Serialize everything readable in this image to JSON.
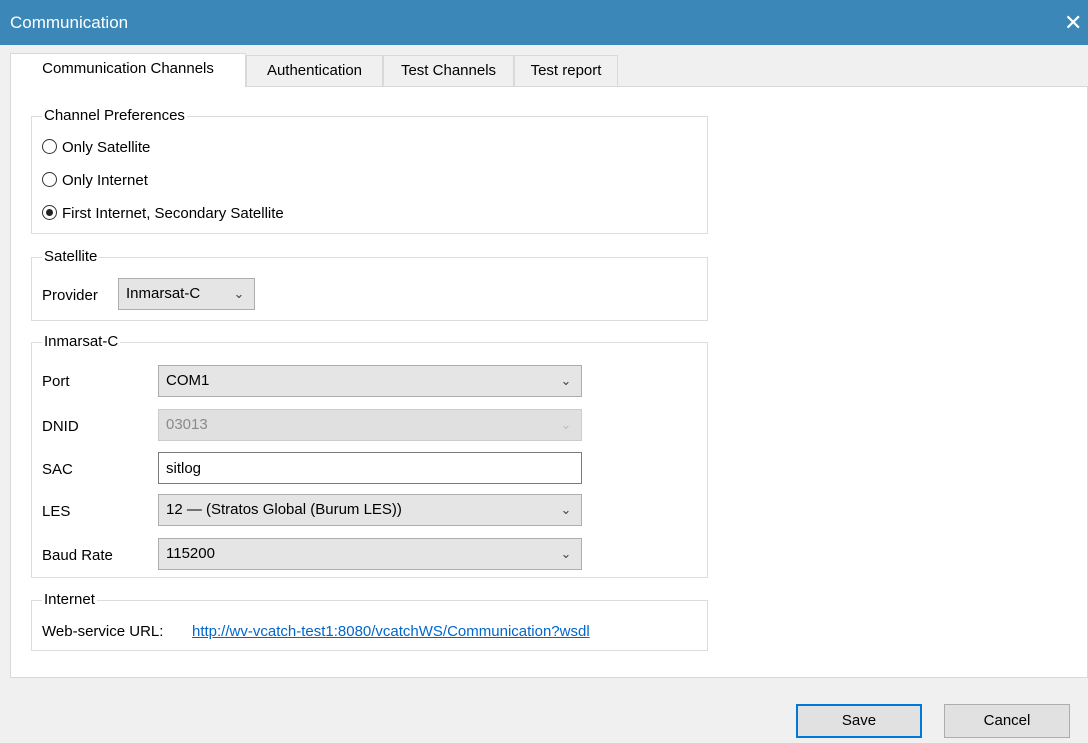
{
  "window": {
    "title": "Communication",
    "close_glyph": "✕"
  },
  "tabs": [
    {
      "label": "Communication Channels",
      "active": true
    },
    {
      "label": "Authentication",
      "active": false
    },
    {
      "label": "Test Channels",
      "active": false
    },
    {
      "label": "Test report",
      "active": false
    }
  ],
  "channel_preferences": {
    "legend": "Channel Preferences",
    "options": [
      {
        "label": "Only Satellite",
        "checked": false
      },
      {
        "label": "Only Internet",
        "checked": false
      },
      {
        "label": "First Internet, Secondary Satellite",
        "checked": true
      }
    ]
  },
  "satellite": {
    "legend": "Satellite",
    "provider_label": "Provider",
    "provider_value": "Inmarsat-C"
  },
  "inmarsat": {
    "legend": "Inmarsat-C",
    "port_label": "Port",
    "port_value": "COM1",
    "dnid_label": "DNID",
    "dnid_value": "03013",
    "sac_label": "SAC",
    "sac_value": "sitlog",
    "les_label": "LES",
    "les_value": "12 — (Stratos Global (Burum LES))",
    "baud_label": "Baud Rate",
    "baud_value": "115200"
  },
  "internet": {
    "legend": "Internet",
    "url_label": "Web-service URL:",
    "url_value": "http://wv-vcatch-test1:8080/vcatchWS/Communication?wsdl"
  },
  "footer": {
    "save_label": "Save",
    "cancel_label": "Cancel"
  }
}
